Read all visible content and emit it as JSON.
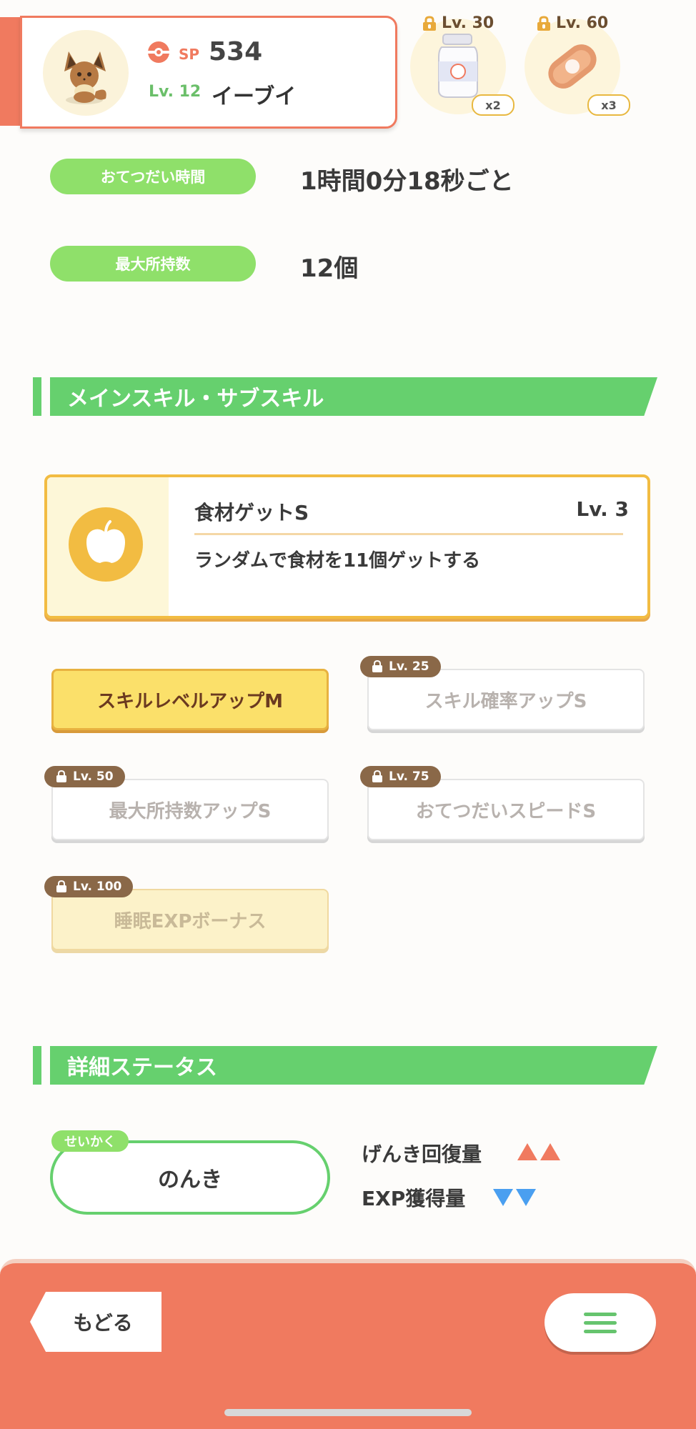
{
  "header": {
    "sp_label": "SP",
    "sp_value": "534",
    "level_label": "Lv. 12",
    "pokemon_name": "イーブイ"
  },
  "locked_ingredients": [
    {
      "level": "Lv. 30",
      "count": "x2",
      "icon": "milk-bottle-icon"
    },
    {
      "level": "Lv. 60",
      "count": "x3",
      "icon": "sausage-icon"
    }
  ],
  "info_rows": [
    {
      "label": "おてつだい時間",
      "value": "1時間0分18秒ごと"
    },
    {
      "label": "最大所持数",
      "value": "12個"
    }
  ],
  "skills_section": {
    "title": "メインスキル・サブスキル",
    "main_skill": {
      "name": "食材ゲットS",
      "level": "Lv. 3",
      "description": "ランダムで食材を11個ゲットする",
      "icon": "apple-icon"
    },
    "sub_skills": [
      {
        "name": "スキルレベルアップM",
        "lock_level": ""
      },
      {
        "name": "スキル確率アップS",
        "lock_level": "Lv. 25"
      },
      {
        "name": "最大所持数アップS",
        "lock_level": "Lv. 50"
      },
      {
        "name": "おてつだいスピードS",
        "lock_level": "Lv. 75"
      },
      {
        "name": "睡眠EXPボーナス",
        "lock_level": "Lv. 100"
      }
    ]
  },
  "status_section": {
    "title": "詳細ステータス",
    "nature_tag": "せいかく",
    "nature": "のんき",
    "effects": [
      {
        "label": "げんき回復量",
        "direction": "up"
      },
      {
        "label": "EXP獲得量",
        "direction": "down"
      }
    ]
  },
  "bottom_bar": {
    "back_label": "もどる",
    "menu_icon": "hamburger-menu-icon"
  },
  "colors": {
    "accent": "#f07a5f",
    "green": "#66d06e",
    "gold": "#f2bc42",
    "up_arrow": "#f07a5f",
    "down_arrow": "#4a9ff0"
  }
}
